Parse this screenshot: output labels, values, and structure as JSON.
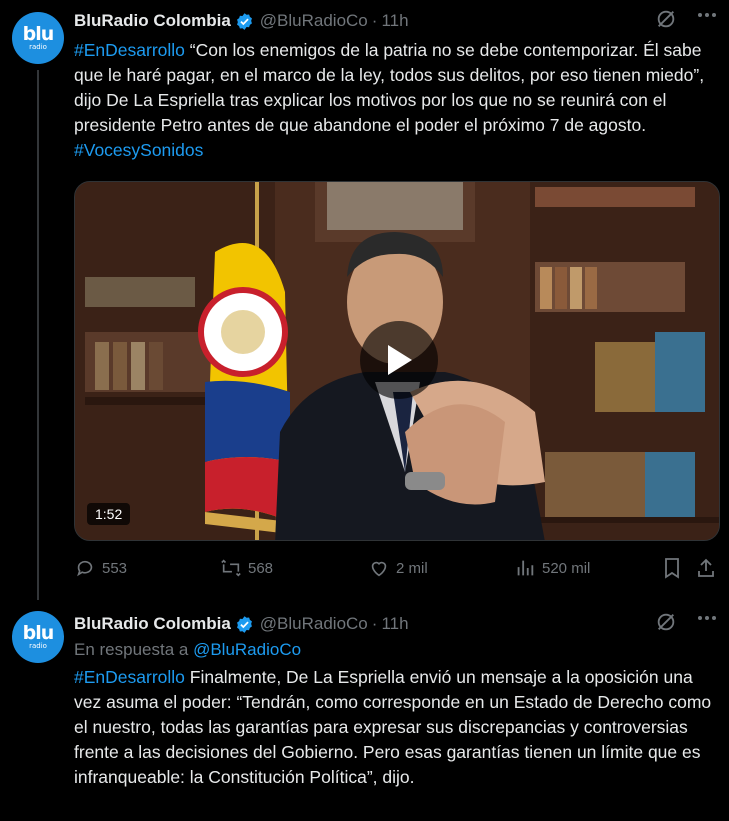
{
  "tweets": [
    {
      "avatar": {
        "brand": "blu",
        "sub": "radio"
      },
      "name": "BluRadio Colombia",
      "handle": "@BluRadioCo",
      "separator": "·",
      "time": "11h",
      "text_parts": [
        {
          "text": "#EnDesarrollo",
          "link": true
        },
        {
          "text": " “Con los enemigos de la patria no se debe contemporizar. Él sabe que le haré pagar, en el marco de la ley, todos sus delitos, por eso tienen miedo”, dijo De La Espriella tras explicar los motivos por los que no se reunirá con el presidente Petro antes de que abandone el poder el próximo 7 de agosto. ",
          "link": false
        },
        {
          "text": "#VocesySonidos",
          "link": true
        }
      ],
      "media": {
        "duration": "1:52"
      },
      "actions": {
        "replies": "553",
        "reposts": "568",
        "likes": "2 mil",
        "views": "520 mil"
      }
    },
    {
      "avatar": {
        "brand": "blu",
        "sub": "radio"
      },
      "name": "BluRadio Colombia",
      "handle": "@BluRadioCo",
      "separator": "·",
      "time": "11h",
      "reply_prefix": "En respuesta a ",
      "reply_handle": "@BluRadioCo",
      "text_parts": [
        {
          "text": "#EnDesarrollo",
          "link": true
        },
        {
          "text": " Finalmente, De La Espriella envió un mensaje a la oposición una vez asuma el poder: “Tendrán, como corresponde en un Estado de Derecho como el nuestro, todas las garantías para expresar sus discrepancias y controversias frente a las decisiones del Gobierno. Pero esas garantías tienen un límite que es infranqueable: la Constitución Política”, dijo.",
          "link": false
        }
      ]
    }
  ],
  "colors": {
    "link": "#1d9bf0",
    "verified": "#1d9bf0",
    "muted": "#71767b",
    "background": "#000000"
  }
}
